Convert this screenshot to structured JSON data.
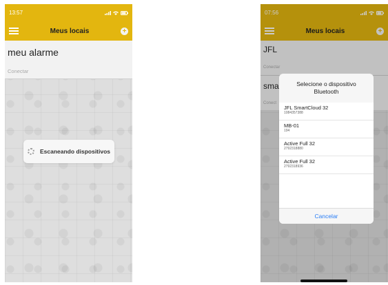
{
  "left": {
    "status_time": "13:57",
    "nav_title": "Meus locais",
    "location_name": "meu alarme",
    "connect_label": "Conectar",
    "scan_text": "Escaneando dispositivos"
  },
  "right": {
    "status_time": "07:56",
    "nav_title": "Meus locais",
    "locations": [
      {
        "name": "JFL",
        "connect": "Conectar"
      },
      {
        "name": "sma",
        "connect": "Conect"
      }
    ],
    "dialog": {
      "title": "Selecione o dispositivo Bluetooth",
      "devices": [
        {
          "name": "JFL SmartCloud 32",
          "serial": "1084357388"
        },
        {
          "name": "MB-01",
          "serial": "194"
        },
        {
          "name": "Active Full 32",
          "serial": "2792318880"
        },
        {
          "name": "Active Full 32",
          "serial": "2792318936"
        }
      ],
      "cancel_label": "Cancelar"
    }
  },
  "colors": {
    "accent": "#e3b60f",
    "link": "#2a7ef5"
  }
}
